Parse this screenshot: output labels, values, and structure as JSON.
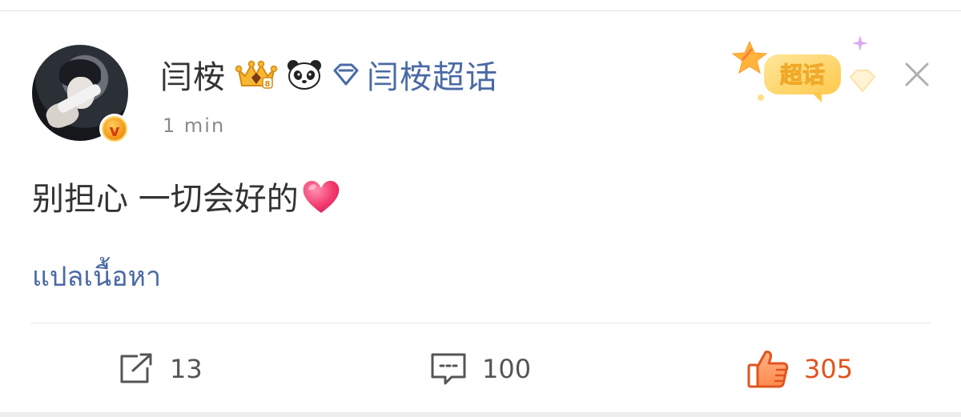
{
  "post": {
    "username": "闫桉",
    "supertopic_link": "闫桉超话",
    "timestamp": "1 min",
    "text": "别担心 一切会好的",
    "translate_label": "แปลเนื้อหา",
    "badge_label": "超话"
  },
  "actions": {
    "share_count": "13",
    "comment_count": "100",
    "like_count": "305"
  },
  "icons": {
    "avatar": "avatar",
    "verify_badge": "verified-v-icon",
    "crown": "crown-icon",
    "panda": "panda-icon",
    "diamond": "diamond-icon",
    "heart": "heart-icon",
    "share": "share-icon",
    "comment": "comment-icon",
    "like": "thumbs-up-icon",
    "close": "close-icon"
  },
  "colors": {
    "link_blue": "#4a6aa5",
    "like_orange": "#e0541e",
    "text_dark": "#333333",
    "meta_gray": "#8a8a8a"
  }
}
